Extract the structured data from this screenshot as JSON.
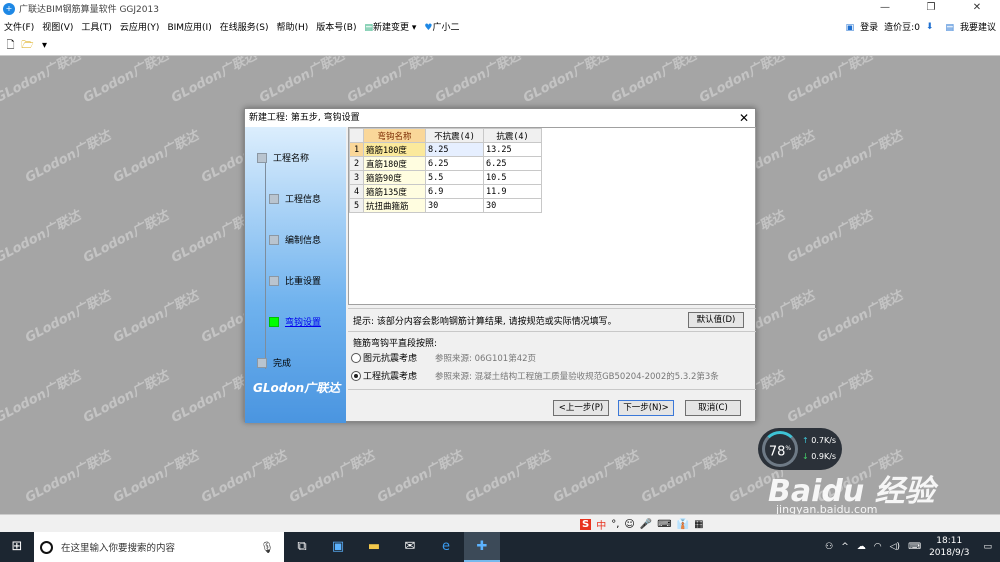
{
  "app": {
    "title": "广联达BIM钢筋算量软件 GGJ2013",
    "min": "—",
    "max": "❐",
    "close": "✕"
  },
  "menu": {
    "items": [
      "文件(F)",
      "视图(V)",
      "工具(T)",
      "云应用(Y)",
      "BIM应用(I)",
      "在线服务(S)",
      "帮助(H)",
      "版本号(B)",
      "新建变更",
      "广小二"
    ],
    "login": "登录",
    "credits": "造价豆:0",
    "suggest": "我要建议"
  },
  "dialog": {
    "title": "新建工程: 第五步, 弯钩设置",
    "close": "✕",
    "steps": [
      "工程名称",
      "工程信息",
      "编制信息",
      "比重设置",
      "弯钩设置",
      "完成"
    ],
    "active_step": 4,
    "brand": "GLodon广联达",
    "table": {
      "headers": [
        "弯钩名称",
        "不抗震(4)",
        "抗震(4)"
      ],
      "rows": [
        {
          "n": "1",
          "name": "箍筋180度",
          "a": "8.25",
          "b": "13.25"
        },
        {
          "n": "2",
          "name": "直筋180度",
          "a": "6.25",
          "b": "6.25"
        },
        {
          "n": "3",
          "name": "箍筋90度",
          "a": "5.5",
          "b": "10.5"
        },
        {
          "n": "4",
          "name": "箍筋135度",
          "a": "6.9",
          "b": "11.9"
        },
        {
          "n": "5",
          "name": "抗扭曲箍筋",
          "a": "30",
          "b": "30"
        }
      ]
    },
    "hint": "提示: 该部分内容会影响钢筋计算结果, 请按规范或实际情况填写。",
    "default_btn": "默认值(D)",
    "options_title": "箍筋弯钩平直段按照:",
    "options": [
      {
        "label": "图元抗震考虑",
        "ref": "参照来源: 06G101第42页",
        "checked": false
      },
      {
        "label": "工程抗震考虑",
        "ref": "参照来源: 混凝土结构工程施工质量验收规范GB50204-2002的5.3.2第3条",
        "checked": true
      }
    ],
    "prev": "<上一步(P)",
    "next": "下一步(N)>",
    "cancel": "取消(C)"
  },
  "watermark": "GLodon广联达",
  "speed": {
    "percent": "78",
    "unit": "%",
    "up": "0.7K/s",
    "down": "0.9K/s"
  },
  "baidu": {
    "logo": "Baidu 经验",
    "url": "jingyan.baidu.com"
  },
  "ime": {
    "label": "中",
    "items": [
      "°,",
      "☺",
      "🎤",
      "⌨",
      "👔",
      "▦"
    ]
  },
  "taskbar": {
    "search_placeholder": "在这里输入你要搜索的内容",
    "time": "18:11",
    "date": "2018/9/3"
  }
}
